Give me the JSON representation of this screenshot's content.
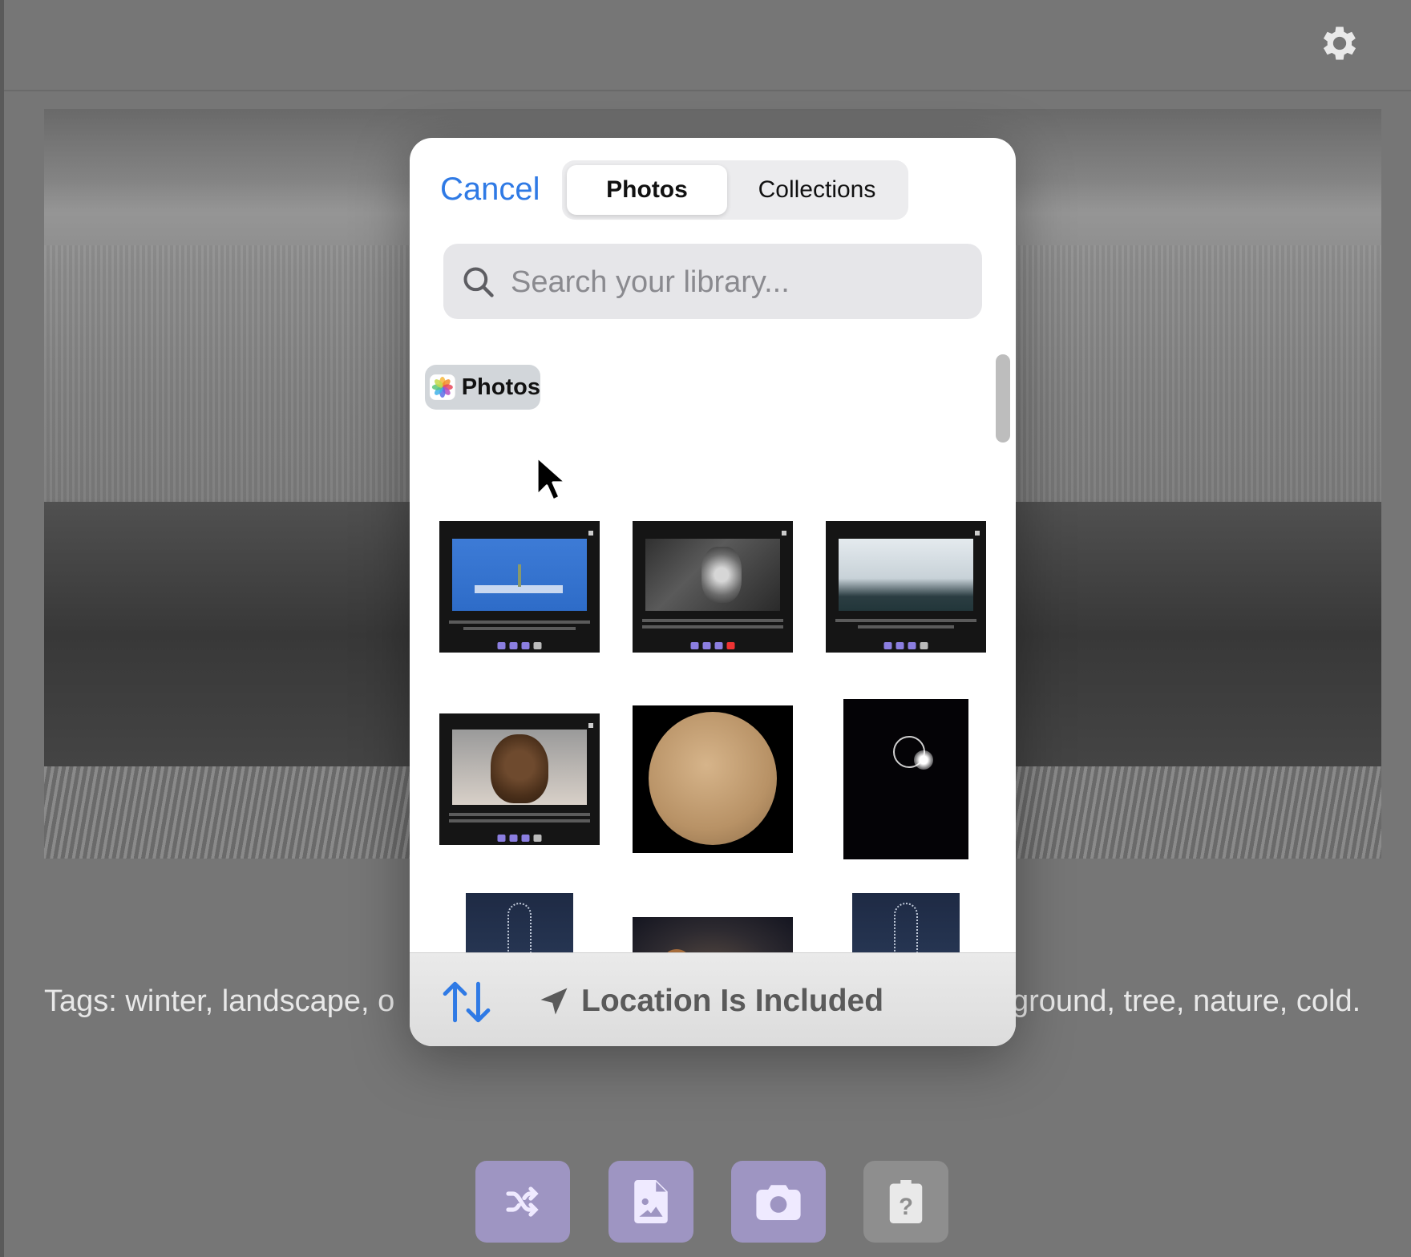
{
  "app": {
    "tags_left": "Tags: winter, landscape, o",
    "tags_right": "ground, tree, nature, cold."
  },
  "modal": {
    "cancel_label": "Cancel",
    "tabs": [
      {
        "label": "Photos",
        "active": true
      },
      {
        "label": "Collections",
        "active": false
      }
    ],
    "search": {
      "placeholder": "Search your library..."
    },
    "source_badge": "Photos",
    "footer": {
      "location_label": "Location Is Included"
    }
  },
  "colors": {
    "accent_blue": "#2f7ae5",
    "toolbar_purple": "#9e95c2",
    "toolbar_gray": "#8e8e8e"
  },
  "icons": [
    "gear-icon",
    "search-icon",
    "photos-app-icon",
    "sort-icon",
    "location-arrow-icon",
    "shuffle-icon",
    "image-file-icon",
    "camera-icon",
    "clipboard-question-icon"
  ]
}
